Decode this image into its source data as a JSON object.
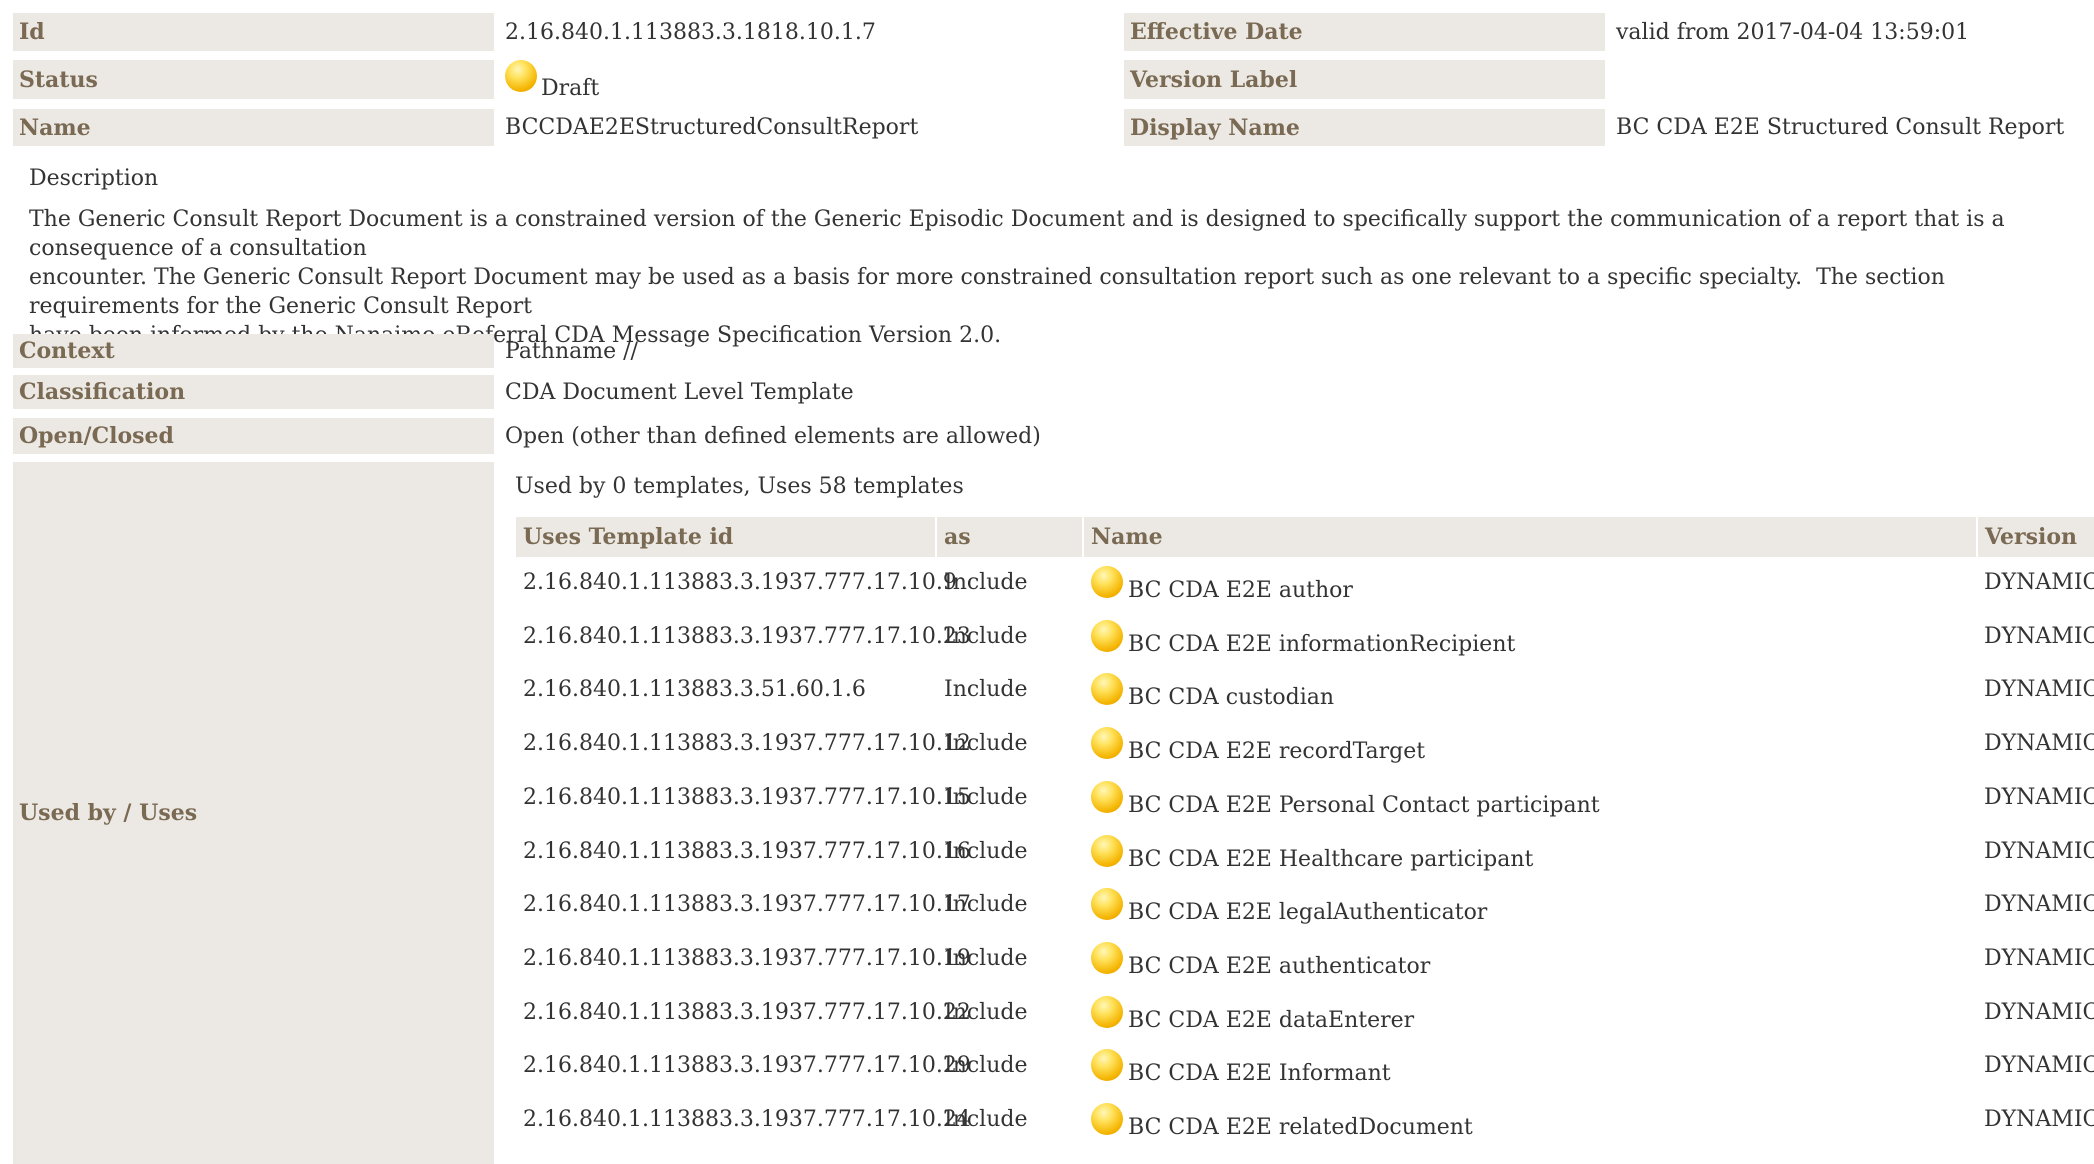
{
  "header": {
    "id_label": "Id",
    "id_value": "2.16.840.1.113883.3.1818.10.1.7",
    "effective_date_label": "Effective Date",
    "effective_date_value": "valid from 2017-04-04 13:59:01",
    "status_label": "Status",
    "status_value": "Draft",
    "version_label_label": "Version Label",
    "version_label_value": "",
    "name_label": "Name",
    "name_value": "BCCDAE2EStructuredConsultReport",
    "display_name_label": "Display Name",
    "display_name_value": "BC CDA E2E Structured Consult Report"
  },
  "description": {
    "title": "Description",
    "text": "The Generic Consult Report Document is a constrained version of the Generic Episodic Document and is designed to specifically support the communication of a report that is a consequence of a consultation\nencounter. The Generic Consult Report Document may be used as a basis for more constrained consultation report such as one relevant to a specific specialty.  The section requirements for the Generic Consult Report\nhave been informed by the Nanaimo eReferral CDA Message Specification Version 2.0."
  },
  "properties": {
    "context_label": "Context",
    "context_value": "Pathname //",
    "classification_label": "Classification",
    "classification_value": "CDA Document Level Template",
    "open_closed_label": "Open/Closed",
    "open_closed_value": "Open (other than defined elements are allowed)",
    "used_by_label": "Used by / Uses"
  },
  "uses": {
    "caption": "Used by 0 templates, Uses 58 templates",
    "columns": [
      "Uses Template id",
      "as",
      "Name",
      "Version"
    ],
    "rows": [
      {
        "id": "2.16.840.1.113883.3.1937.777.17.10.9",
        "as": "Include",
        "name": "BC CDA E2E author",
        "version": "DYNAMIC"
      },
      {
        "id": "2.16.840.1.113883.3.1937.777.17.10.23",
        "as": "Include",
        "name": "BC CDA E2E informationRecipient",
        "version": "DYNAMIC"
      },
      {
        "id": "2.16.840.1.113883.3.51.60.1.6",
        "as": "Include",
        "name": "BC CDA custodian",
        "version": "DYNAMIC"
      },
      {
        "id": "2.16.840.1.113883.3.1937.777.17.10.12",
        "as": "Include",
        "name": "BC CDA E2E recordTarget",
        "version": "DYNAMIC"
      },
      {
        "id": "2.16.840.1.113883.3.1937.777.17.10.15",
        "as": "Include",
        "name": "BC CDA E2E Personal Contact participant",
        "version": "DYNAMIC"
      },
      {
        "id": "2.16.840.1.113883.3.1937.777.17.10.16",
        "as": "Include",
        "name": "BC CDA E2E Healthcare participant",
        "version": "DYNAMIC"
      },
      {
        "id": "2.16.840.1.113883.3.1937.777.17.10.17",
        "as": "Include",
        "name": "BC CDA E2E legalAuthenticator",
        "version": "DYNAMIC"
      },
      {
        "id": "2.16.840.1.113883.3.1937.777.17.10.19",
        "as": "Include",
        "name": "BC CDA E2E authenticator",
        "version": "DYNAMIC"
      },
      {
        "id": "2.16.840.1.113883.3.1937.777.17.10.22",
        "as": "Include",
        "name": "BC CDA E2E dataEnterer",
        "version": "DYNAMIC"
      },
      {
        "id": "2.16.840.1.113883.3.1937.777.17.10.29",
        "as": "Include",
        "name": "BC CDA E2E Informant",
        "version": "DYNAMIC"
      },
      {
        "id": "2.16.840.1.113883.3.1937.777.17.10.24",
        "as": "Include",
        "name": "BC CDA E2E relatedDocument",
        "version": "DYNAMIC"
      }
    ]
  },
  "colors": {
    "label_background": "#ece9e4",
    "label_text": "#7a6a53",
    "status_draft": "#f4b400"
  },
  "icons": {
    "status_icon": "draft-status-icon"
  }
}
